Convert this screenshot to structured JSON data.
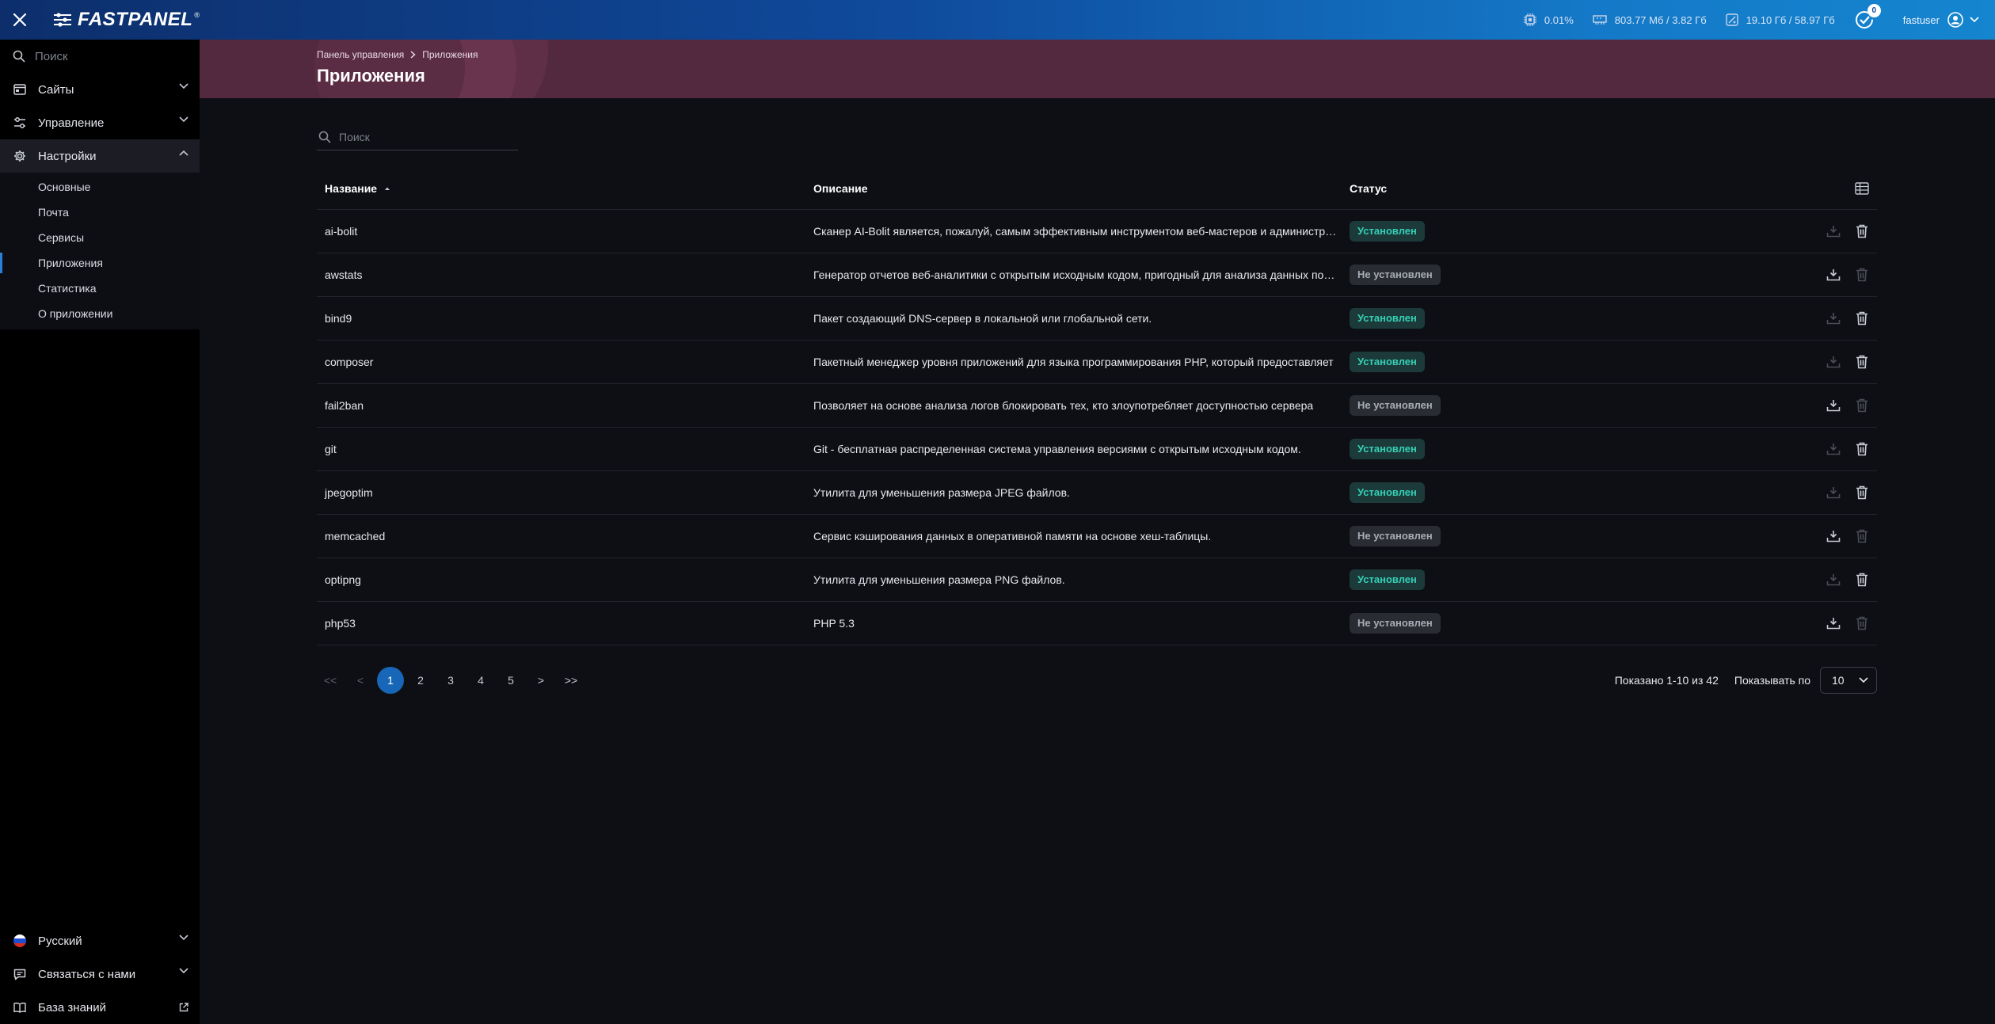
{
  "topbar": {
    "logo": "FASTPANEL",
    "logo_reg": "®",
    "cpu": "0.01%",
    "ram": "803.77 Мб / 3.82 Гб",
    "disk": "19.10 Гб / 58.97 Гб",
    "notifications": "0",
    "user": "fastuser"
  },
  "sidebar": {
    "search_placeholder": "Поиск",
    "items": [
      {
        "label": "Сайты",
        "icon": "sites-icon"
      },
      {
        "label": "Управление",
        "icon": "sliders-icon"
      },
      {
        "label": "Настройки",
        "icon": "gear-icon"
      }
    ],
    "sub_items": [
      "Основные",
      "Почта",
      "Сервисы",
      "Приложения",
      "Статистика",
      "О приложении"
    ],
    "active_sub": "Приложения",
    "bottom": {
      "language": "Русский",
      "contact": "Связаться с нами",
      "knowledge": "База знаний"
    }
  },
  "header": {
    "breadcrumb_root": "Панель управления",
    "breadcrumb_current": "Приложения",
    "title": "Приложения"
  },
  "search": {
    "placeholder": "Поиск"
  },
  "table": {
    "columns": {
      "name": "Название",
      "description": "Описание",
      "status": "Статус"
    },
    "rows": [
      {
        "name": "ai-bolit",
        "description": "Сканер AI-Bolit является, пожалуй, самым эффективным инструментом веб-мастеров и администраторов",
        "status": "Установлен",
        "installed": true
      },
      {
        "name": "awstats",
        "description": "Генератор отчетов веб-аналитики с открытым исходным кодом, пригодный для анализа данных посещаемости",
        "status": "Не установлен",
        "installed": false
      },
      {
        "name": "bind9",
        "description": "Пакет создающий DNS-сервер в локальной или глобальной сети.",
        "status": "Установлен",
        "installed": true
      },
      {
        "name": "composer",
        "description": "Пакетный менеджер уровня приложений для языка программирования PHP, который предоставляет",
        "status": "Установлен",
        "installed": true
      },
      {
        "name": "fail2ban",
        "description": "Позволяет на основе анализа логов блокировать тех, кто злоупотребляет доступностью сервера",
        "status": "Не установлен",
        "installed": false
      },
      {
        "name": "git",
        "description": "Git - бесплатная распределенная система управления версиями с открытым исходным кодом.",
        "status": "Установлен",
        "installed": true
      },
      {
        "name": "jpegoptim",
        "description": "Утилита для уменьшения размера JPEG файлов.",
        "status": "Установлен",
        "installed": true
      },
      {
        "name": "memcached",
        "description": "Сервис кэширования данных в оперативной памяти на основе хеш-таблицы.",
        "status": "Не установлен",
        "installed": false
      },
      {
        "name": "optipng",
        "description": "Утилита для уменьшения размера PNG файлов.",
        "status": "Установлен",
        "installed": true
      },
      {
        "name": "php53",
        "description": "PHP 5.3",
        "status": "Не установлен",
        "installed": false
      }
    ]
  },
  "pagination": {
    "first": "<<",
    "prev": "<",
    "next": ">",
    "last": ">>",
    "pages": [
      "1",
      "2",
      "3",
      "4",
      "5"
    ],
    "current": "1",
    "shown": "Показано 1-10 из 42",
    "per_page_label": "Показывать по",
    "per_page_value": "10"
  },
  "colors": {
    "accent": "#1766b8",
    "installed_text": "#35d0b6",
    "header_band": "#52293f"
  }
}
